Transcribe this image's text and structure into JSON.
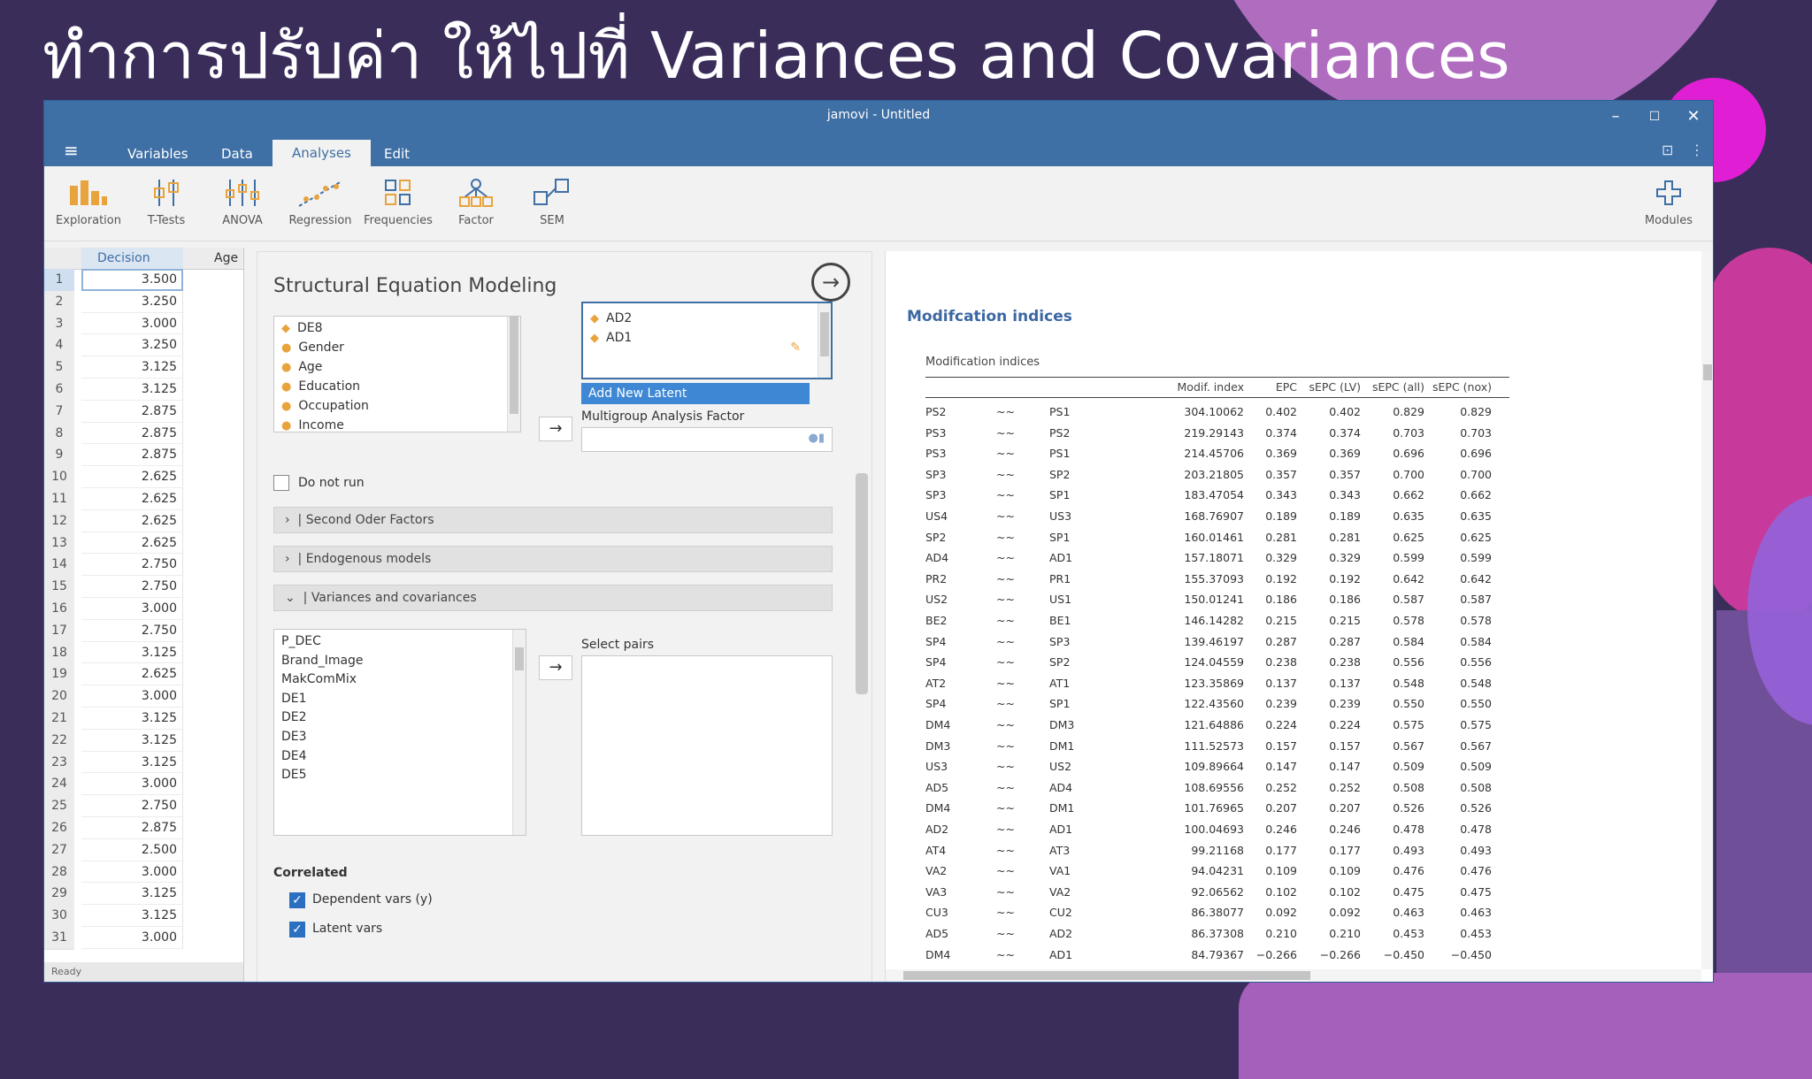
{
  "slide": {
    "title": "ทำการปรับค่า ให้ไปที่ Variances and Covariances"
  },
  "window": {
    "title": "jamovi - Untitled",
    "controls": [
      "–",
      "☐",
      "✕"
    ]
  },
  "menu": {
    "tabs": [
      "Variables",
      "Data",
      "Analyses",
      "Edit"
    ],
    "active": "Analyses"
  },
  "ribbon": {
    "items": [
      {
        "label": "Exploration",
        "icon": "exploration-icon"
      },
      {
        "label": "T-Tests",
        "icon": "t-tests-icon"
      },
      {
        "label": "ANOVA",
        "icon": "anova-icon"
      },
      {
        "label": "Regression",
        "icon": "regression-icon"
      },
      {
        "label": "Frequencies",
        "icon": "frequencies-icon"
      },
      {
        "label": "Factor",
        "icon": "factor-icon"
      },
      {
        "label": "SEM",
        "icon": "sem-icon"
      }
    ],
    "modules": "Modules"
  },
  "grid": {
    "columns": [
      "Decision",
      "Age"
    ],
    "rows": [
      {
        "n": "1",
        "v": "3.500"
      },
      {
        "n": "2",
        "v": "3.250"
      },
      {
        "n": "3",
        "v": "3.000"
      },
      {
        "n": "4",
        "v": "3.250"
      },
      {
        "n": "5",
        "v": "3.125"
      },
      {
        "n": "6",
        "v": "3.125"
      },
      {
        "n": "7",
        "v": "2.875"
      },
      {
        "n": "8",
        "v": "2.875"
      },
      {
        "n": "9",
        "v": "2.875"
      },
      {
        "n": "10",
        "v": "2.625"
      },
      {
        "n": "11",
        "v": "2.625"
      },
      {
        "n": "12",
        "v": "2.625"
      },
      {
        "n": "13",
        "v": "2.625"
      },
      {
        "n": "14",
        "v": "2.750"
      },
      {
        "n": "15",
        "v": "2.750"
      },
      {
        "n": "16",
        "v": "3.000"
      },
      {
        "n": "17",
        "v": "2.750"
      },
      {
        "n": "18",
        "v": "3.125"
      },
      {
        "n": "19",
        "v": "2.625"
      },
      {
        "n": "20",
        "v": "3.000"
      },
      {
        "n": "21",
        "v": "3.125"
      },
      {
        "n": "22",
        "v": "3.125"
      },
      {
        "n": "23",
        "v": "3.125"
      },
      {
        "n": "24",
        "v": "3.000"
      },
      {
        "n": "25",
        "v": "2.750"
      },
      {
        "n": "26",
        "v": "2.875"
      },
      {
        "n": "27",
        "v": "2.500"
      },
      {
        "n": "28",
        "v": "3.000"
      },
      {
        "n": "29",
        "v": "3.125"
      },
      {
        "n": "30",
        "v": "3.125"
      },
      {
        "n": "31",
        "v": "3.000"
      }
    ],
    "status": "Ready"
  },
  "sem": {
    "title": "Structural Equation Modeling",
    "vars_list": [
      "DE8",
      "Gender",
      "Age",
      "Education",
      "Occupation",
      "Income"
    ],
    "latent_items": [
      "AD2",
      "AD1"
    ],
    "add_latent": "Add New Latent",
    "multigroup_label": "Multigroup Analysis Factor",
    "do_not_run": "Do not run",
    "sections": [
      "Second Oder Factors",
      "Endogenous models",
      "Variances and covariances"
    ],
    "cov_vars": [
      "P_DEC",
      "Brand_Image",
      "MakComMix",
      "DE1",
      "DE2",
      "DE3",
      "DE4",
      "DE5"
    ],
    "select_pairs": "Select pairs",
    "correlated": "Correlated",
    "dep_vars": "Dependent vars (y)",
    "latent_vars": "Latent vars"
  },
  "results": {
    "heading": "Modifcation indices",
    "caption": "Modification indices",
    "headers": [
      "Modif. index",
      "EPC",
      "sEPC (LV)",
      "sEPC (all)",
      "sEPC (nox)"
    ],
    "rows": [
      [
        "PS2",
        "~~",
        "PS1",
        "304.10062",
        "0.402",
        "0.402",
        "0.829",
        "0.829"
      ],
      [
        "PS3",
        "~~",
        "PS2",
        "219.29143",
        "0.374",
        "0.374",
        "0.703",
        "0.703"
      ],
      [
        "PS3",
        "~~",
        "PS1",
        "214.45706",
        "0.369",
        "0.369",
        "0.696",
        "0.696"
      ],
      [
        "SP3",
        "~~",
        "SP2",
        "203.21805",
        "0.357",
        "0.357",
        "0.700",
        "0.700"
      ],
      [
        "SP3",
        "~~",
        "SP1",
        "183.47054",
        "0.343",
        "0.343",
        "0.662",
        "0.662"
      ],
      [
        "US4",
        "~~",
        "US3",
        "168.76907",
        "0.189",
        "0.189",
        "0.635",
        "0.635"
      ],
      [
        "SP2",
        "~~",
        "SP1",
        "160.01461",
        "0.281",
        "0.281",
        "0.625",
        "0.625"
      ],
      [
        "AD4",
        "~~",
        "AD1",
        "157.18071",
        "0.329",
        "0.329",
        "0.599",
        "0.599"
      ],
      [
        "PR2",
        "~~",
        "PR1",
        "155.37093",
        "0.192",
        "0.192",
        "0.642",
        "0.642"
      ],
      [
        "US2",
        "~~",
        "US1",
        "150.01241",
        "0.186",
        "0.186",
        "0.587",
        "0.587"
      ],
      [
        "BE2",
        "~~",
        "BE1",
        "146.14282",
        "0.215",
        "0.215",
        "0.578",
        "0.578"
      ],
      [
        "SP4",
        "~~",
        "SP3",
        "139.46197",
        "0.287",
        "0.287",
        "0.584",
        "0.584"
      ],
      [
        "SP4",
        "~~",
        "SP2",
        "124.04559",
        "0.238",
        "0.238",
        "0.556",
        "0.556"
      ],
      [
        "AT2",
        "~~",
        "AT1",
        "123.35869",
        "0.137",
        "0.137",
        "0.548",
        "0.548"
      ],
      [
        "SP4",
        "~~",
        "SP1",
        "122.43560",
        "0.239",
        "0.239",
        "0.550",
        "0.550"
      ],
      [
        "DM4",
        "~~",
        "DM3",
        "121.64886",
        "0.224",
        "0.224",
        "0.575",
        "0.575"
      ],
      [
        "DM3",
        "~~",
        "DM1",
        "111.52573",
        "0.157",
        "0.157",
        "0.567",
        "0.567"
      ],
      [
        "US3",
        "~~",
        "US2",
        "109.89664",
        "0.147",
        "0.147",
        "0.509",
        "0.509"
      ],
      [
        "AD5",
        "~~",
        "AD4",
        "108.69556",
        "0.252",
        "0.252",
        "0.508",
        "0.508"
      ],
      [
        "DM4",
        "~~",
        "DM1",
        "101.76965",
        "0.207",
        "0.207",
        "0.526",
        "0.526"
      ],
      [
        "AD2",
        "~~",
        "AD1",
        "100.04693",
        "0.246",
        "0.246",
        "0.478",
        "0.478"
      ],
      [
        "AT4",
        "~~",
        "AT3",
        "99.21168",
        "0.177",
        "0.177",
        "0.493",
        "0.493"
      ],
      [
        "VA2",
        "~~",
        "VA1",
        "94.04231",
        "0.109",
        "0.109",
        "0.476",
        "0.476"
      ],
      [
        "VA3",
        "~~",
        "VA2",
        "92.06562",
        "0.102",
        "0.102",
        "0.475",
        "0.475"
      ],
      [
        "CU3",
        "~~",
        "CU2",
        "86.38077",
        "0.092",
        "0.092",
        "0.463",
        "0.463"
      ],
      [
        "AD5",
        "~~",
        "AD2",
        "86.37308",
        "0.210",
        "0.210",
        "0.453",
        "0.453"
      ],
      [
        "DM4",
        "~~",
        "AD1",
        "84.79367",
        "−0.266",
        "−0.266",
        "−0.450",
        "−0.450"
      ]
    ]
  }
}
